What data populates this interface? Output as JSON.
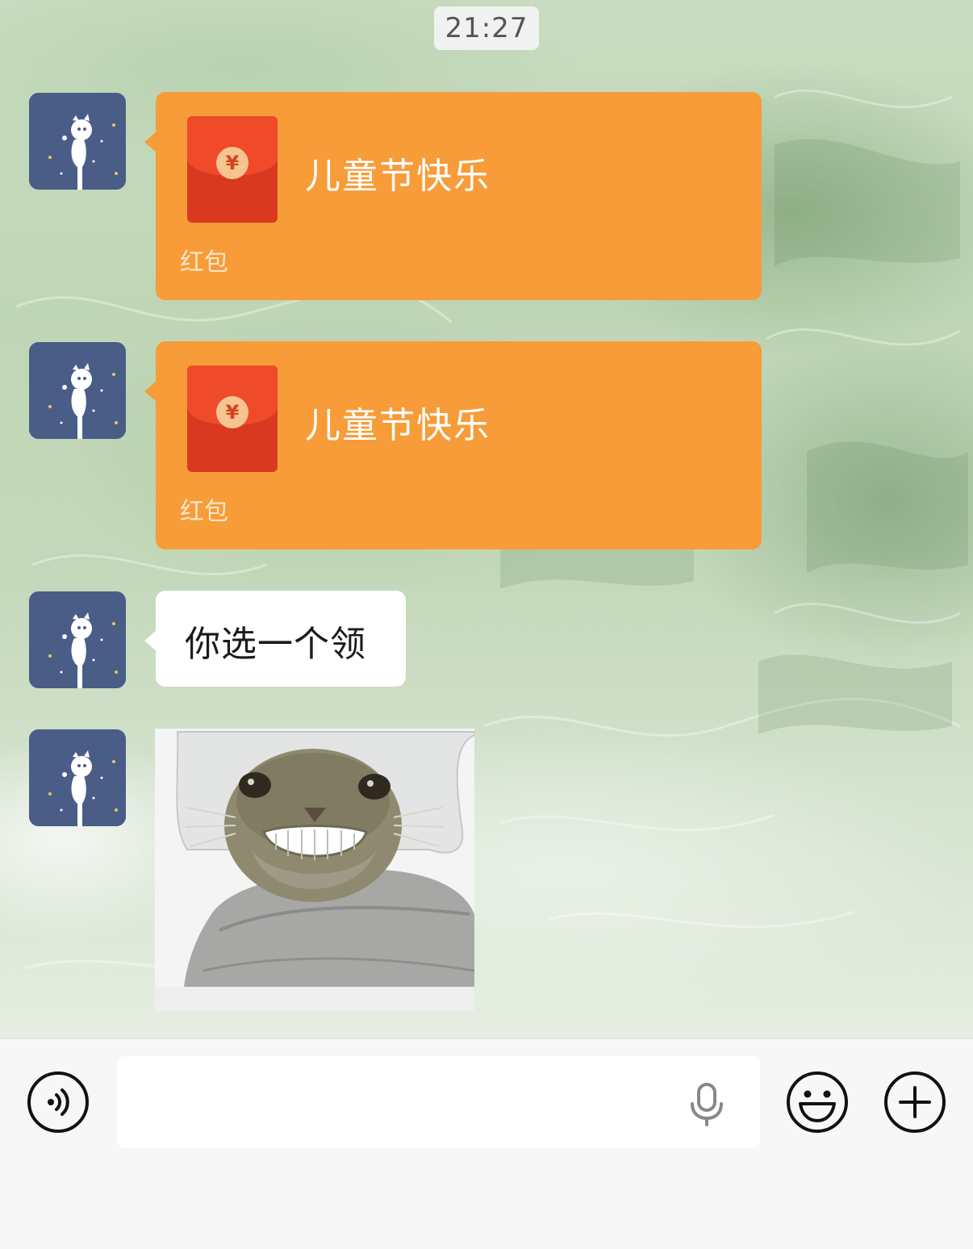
{
  "chat": {
    "timestamp": "21:27",
    "messages": [
      {
        "type": "red_packet",
        "title": "儿童节快乐",
        "label": "红包",
        "currency_symbol": "¥"
      },
      {
        "type": "red_packet",
        "title": "儿童节快乐",
        "label": "红包",
        "currency_symbol": "¥"
      },
      {
        "type": "text",
        "text": "你选一个领"
      },
      {
        "type": "sticker",
        "icon": "smiling-cat-sticker"
      }
    ]
  },
  "input_bar": {
    "voice_icon": "voice-mode-icon",
    "input_value": "",
    "input_placeholder": "",
    "mic_icon": "microphone-icon",
    "emoji_icon": "emoji-icon",
    "more_icon": "plus-icon"
  },
  "colors": {
    "packet_orange": "#f79c38",
    "envelope_red": "#d93a1f",
    "avatar_blue": "#4a5d87",
    "bubble_white": "#ffffff"
  }
}
